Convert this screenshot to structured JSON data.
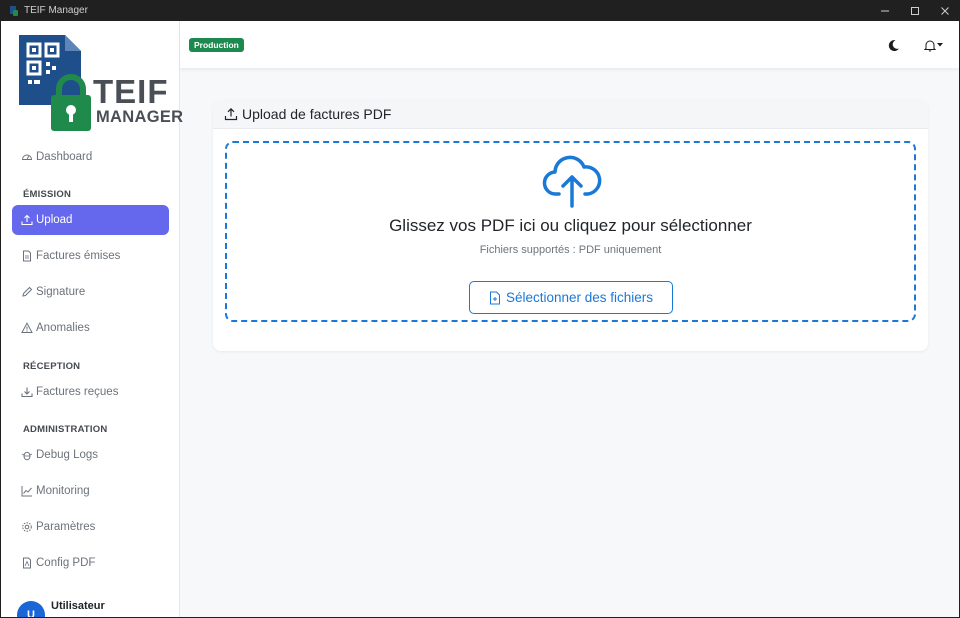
{
  "window": {
    "title": "TEIF Manager",
    "controls": [
      "minimize-icon",
      "maximize-icon",
      "close-icon"
    ]
  },
  "logo": {
    "line1": "TEIF",
    "line2": "MANAGER"
  },
  "sidebar": {
    "dashboard": "Dashboard",
    "sections": {
      "emission": "ÉMISSION",
      "reception": "RÉCEPTION",
      "administration": "ADMINISTRATION"
    },
    "items": {
      "upload": "Upload",
      "factures_emises": "Factures émises",
      "signature": "Signature",
      "anomalies": "Anomalies",
      "factures_recues": "Factures reçues",
      "debug_logs": "Debug Logs",
      "monitoring": "Monitoring",
      "parametres": "Paramètres",
      "config_pdf": "Config PDF"
    },
    "active": "upload",
    "user": {
      "name": "Utilisateur",
      "initial": "U"
    }
  },
  "topbar": {
    "environment_badge": "Production",
    "icons": [
      "moon-icon",
      "bell-icon"
    ]
  },
  "upload_card": {
    "header": "Upload de factures PDF",
    "drop_title": "Glissez vos PDF ici ou cliquez pour sélectionner",
    "drop_subtitle": "Fichiers supportés : PDF uniquement",
    "button_label": "Sélectionner des fichiers"
  },
  "colors": {
    "accent": "#6567ec",
    "primary_blue": "#1a78d6",
    "production_badge": "#1c8a4e",
    "logo_green": "#1f8a4c",
    "logo_blue": "#1e4f8a",
    "logo_gray": "#4a4f55"
  }
}
